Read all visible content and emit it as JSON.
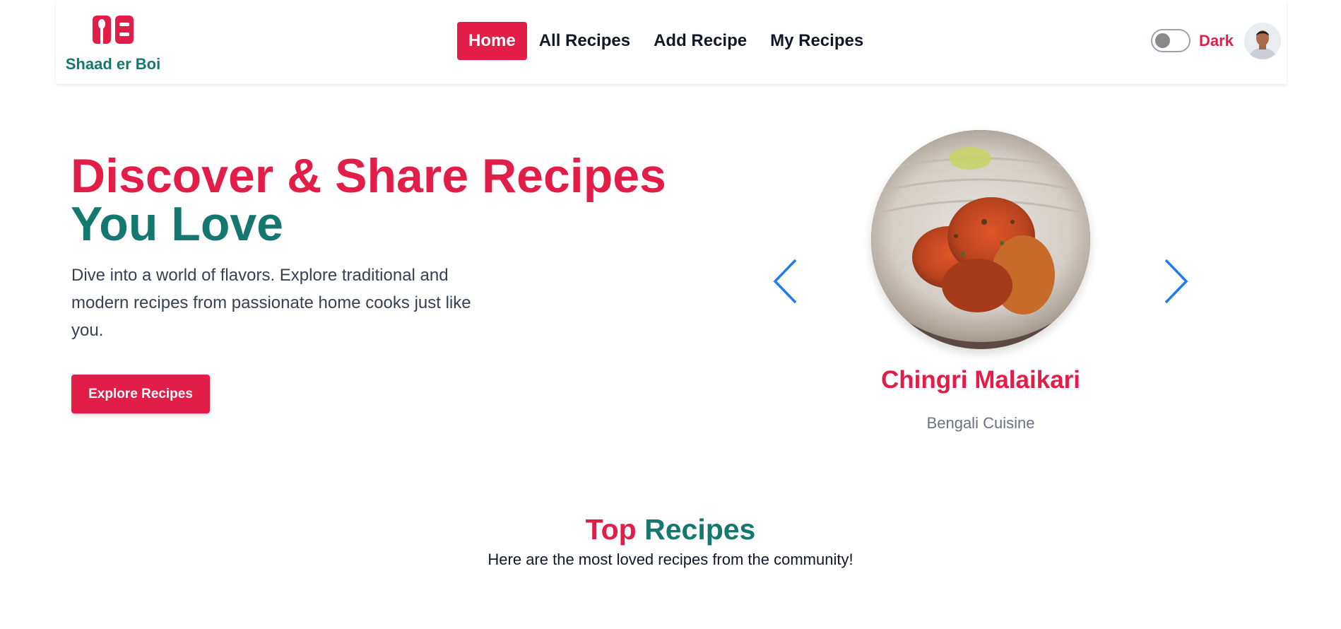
{
  "brand": {
    "name": "Shaad er Boi",
    "logo_icon": "recipe-book-spoon-logo",
    "color": "#14786e"
  },
  "nav": {
    "items": [
      {
        "label": "Home",
        "active": true
      },
      {
        "label": "All Recipes",
        "active": false
      },
      {
        "label": "Add Recipe",
        "active": false
      },
      {
        "label": "My Recipes",
        "active": false
      }
    ]
  },
  "theme_toggle": {
    "label": "Dark",
    "checked": false
  },
  "user": {
    "avatar_icon": "user-avatar"
  },
  "hero": {
    "title_line1": "Discover & Share Recipes",
    "title_line2": "You Love",
    "description": "Dive into a world of flavors. Explore traditional and modern recipes from passionate home cooks just like you.",
    "cta_label": "Explore Recipes"
  },
  "carousel": {
    "prev_icon": "chevron-left-icon",
    "next_icon": "chevron-right-icon",
    "current": {
      "name": "Chingri Malaikari",
      "cuisine": "Bengali Cuisine"
    }
  },
  "top_recipes": {
    "title_part1": "Top",
    "title_part2": "Recipes",
    "subtitle": "Here are the most loved recipes from the community!"
  },
  "colors": {
    "accent": "#e11d48",
    "secondary": "#14786e",
    "link_blue": "#1d7cf2"
  }
}
